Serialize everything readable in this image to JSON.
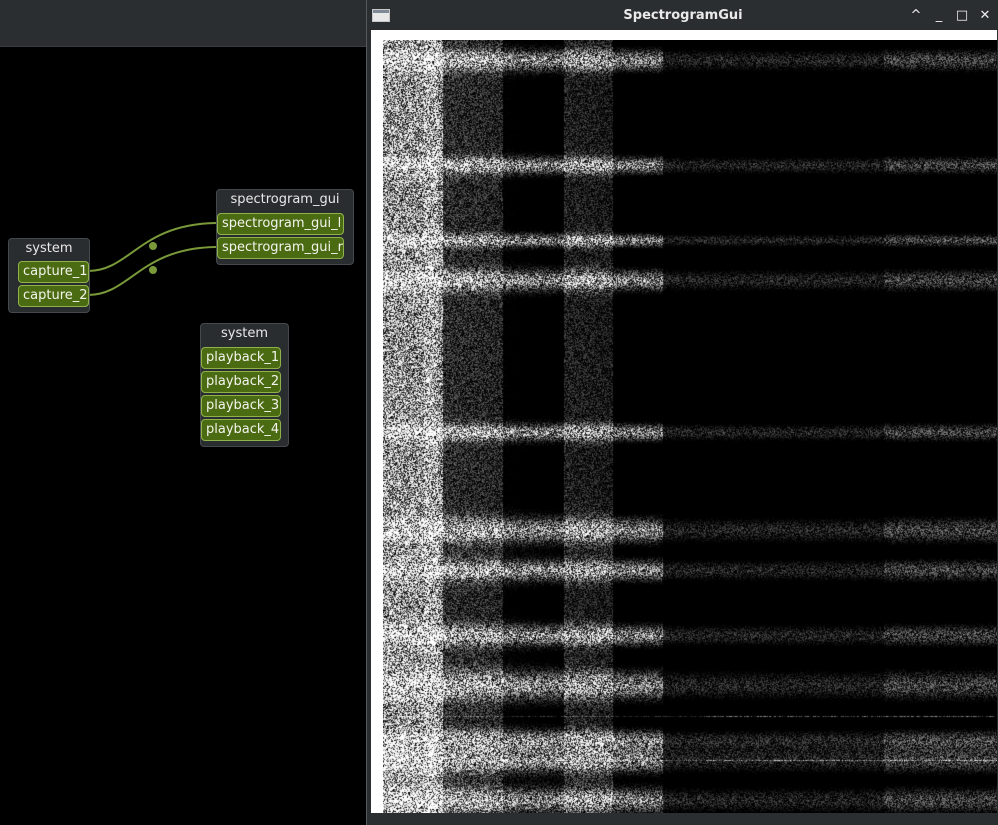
{
  "patchbay": {
    "system_capture": {
      "title": "system",
      "ports": [
        "capture_1",
        "capture_2"
      ]
    },
    "spectrogram_node": {
      "title": "spectrogram_gui",
      "ports": [
        "spectrogram_gui_l",
        "spectrogram_gui_r"
      ]
    },
    "system_playback": {
      "title": "system",
      "ports": [
        "playback_1",
        "playback_2",
        "playback_3",
        "playback_4"
      ]
    },
    "wire_color": "#7a9a3a",
    "connections": [
      {
        "from": "capture_1",
        "to": "spectrogram_gui_l"
      },
      {
        "from": "capture_2",
        "to": "spectrogram_gui_r"
      }
    ]
  },
  "window": {
    "title": "SpectrogramGui",
    "icon": "window-app-icon",
    "buttons": {
      "shade": "^",
      "minimize": "_",
      "maximize": "□",
      "close": "✕"
    }
  },
  "spectrogram": {
    "colormap": "grayscale",
    "background": "#000000"
  }
}
